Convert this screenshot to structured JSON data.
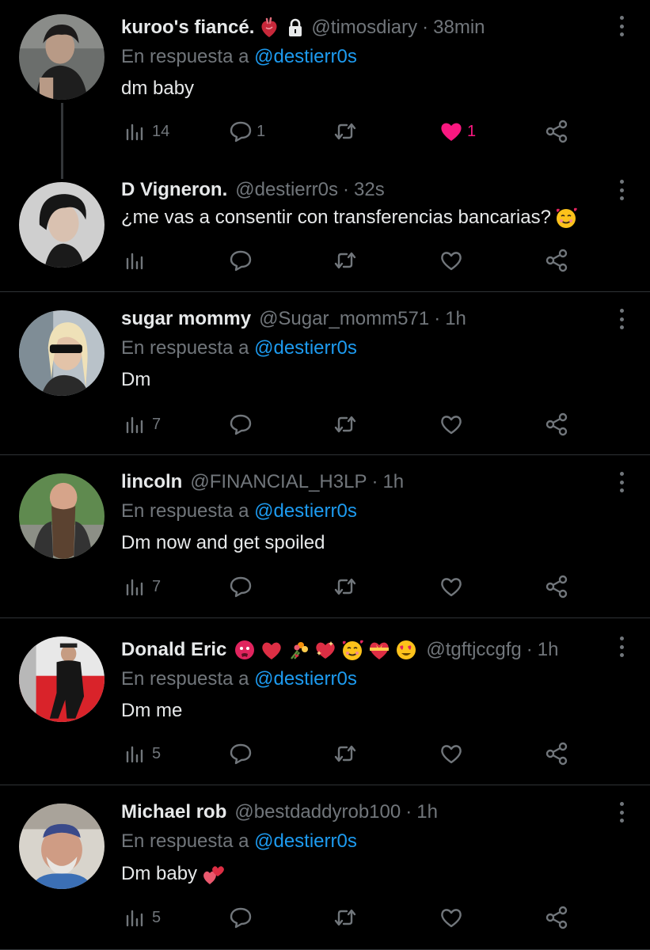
{
  "reply_prefix": "En respuesta a",
  "tweets": [
    {
      "name": "kuroo's fiancé.",
      "handle": "@timosdiary",
      "time": "38min",
      "reply_to": "@destierr0s",
      "text": "dm baby",
      "views": "14",
      "replies": "1",
      "retweets": "",
      "likes": "1",
      "liked": true,
      "name_emojis": [
        "anatomical-heart-emoji"
      ],
      "protected": true
    },
    {
      "name": "D Vigneron.",
      "handle": "@destierr0s",
      "time": "32s",
      "reply_to": "",
      "text": "¿me vas a consentir con transferencias bancarias?",
      "text_emoji": "smiling-face-with-hearts-emoji",
      "views": "",
      "replies": "",
      "retweets": "",
      "likes": "",
      "liked": false
    },
    {
      "name": "sugar mommy",
      "handle": "@Sugar_momm571",
      "time": "1h",
      "reply_to": "@destierr0s",
      "text": "Dm",
      "views": "7",
      "replies": "",
      "retweets": "",
      "likes": "",
      "liked": false
    },
    {
      "name": "lincoln",
      "handle": "@FINANCIAL_H3LP",
      "time": "1h",
      "reply_to": "@destierr0s",
      "text": "Dm now and get spoiled",
      "views": "7",
      "replies": "",
      "retweets": "",
      "likes": "",
      "liked": false
    },
    {
      "name": "Donald Eric",
      "handle": "@tgftjccgfg",
      "time": "1h",
      "reply_to": "@destierr0s",
      "text": "Dm me",
      "views": "5",
      "replies": "",
      "retweets": "",
      "likes": "",
      "liked": false,
      "name_emojis": [
        "hot-face-emoji",
        "red-heart-emoji",
        "bouquet-emoji",
        "heart-exclamation-emoji",
        "smiling-face-with-hearts-emoji",
        "heart-with-ribbon-emoji",
        "heart-eyes-emoji"
      ]
    },
    {
      "name": "Michael rob",
      "handle": "@bestdaddyrob100",
      "time": "1h",
      "reply_to": "@destierr0s",
      "text": "Dm baby",
      "text_emoji": "two-hearts-emoji",
      "views": "5",
      "replies": "",
      "retweets": "",
      "likes": "",
      "liked": false
    }
  ],
  "colors": {
    "background": "#000000",
    "text": "#e7e9ea",
    "muted": "#71767b",
    "mention": "#1d9bf0",
    "like": "#f91880",
    "divider": "#2f3336"
  }
}
